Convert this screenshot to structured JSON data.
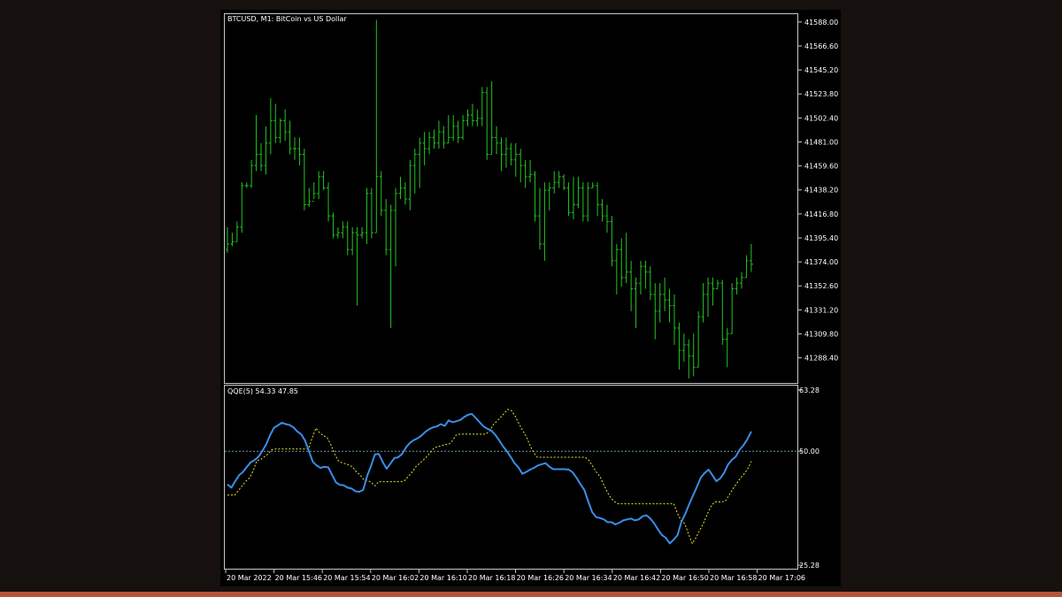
{
  "colors": {
    "page_bg": "#16110e",
    "chart_bg": "#000000",
    "frame": "#c8c8c8",
    "candle": "#22c422",
    "qqe_line": "#3a8ee6",
    "qqe_signal": "#e6e632",
    "level_line": "#6a9ab0",
    "text": "#ffffff",
    "bottom_strip": "#b5543a"
  },
  "chart_data": [
    {
      "type": "ohlc",
      "title": "BTCUSD, M1:  BitCoin vs US Dollar",
      "ylim": [
        41266,
        41595
      ],
      "y_ticks": [
        "41588.00",
        "41566.60",
        "41545.20",
        "41523.80",
        "41502.40",
        "41481.00",
        "41459.60",
        "41438.20",
        "41416.80",
        "41395.40",
        "41374.00",
        "41352.60",
        "41331.20",
        "41309.80",
        "41288.40"
      ],
      "x_ticks": [
        "20 Mar 2022",
        "20 Mar 15:46",
        "20 Mar 15:54",
        "20 Mar 16:02",
        "20 Mar 16:10",
        "20 Mar 16:18",
        "20 Mar 16:26",
        "20 Mar 16:34",
        "20 Mar 16:42",
        "20 Mar 16:50",
        "20 Mar 16:58",
        "20 Mar 17:06"
      ],
      "bars": [
        [
          41385,
          41382,
          41405,
          41390
        ],
        [
          41390,
          41388,
          41400,
          41392
        ],
        [
          41392,
          41392,
          41410,
          41405
        ],
        [
          41405,
          41400,
          41445,
          41442
        ],
        [
          41442,
          41440,
          41445,
          41442
        ],
        [
          41442,
          41440,
          41465,
          41460
        ],
        [
          41460,
          41455,
          41505,
          41470
        ],
        [
          41470,
          41455,
          41480,
          41460
        ],
        [
          41460,
          41452,
          41495,
          41480
        ],
        [
          41480,
          41470,
          41520,
          41500
        ],
        [
          41500,
          41480,
          41515,
          41485
        ],
        [
          41485,
          41480,
          41502,
          41500
        ],
        [
          41500,
          41482,
          41510,
          41490
        ],
        [
          41490,
          41470,
          41500,
          41475
        ],
        [
          41475,
          41465,
          41485,
          41475
        ],
        [
          41475,
          41460,
          41485,
          41470
        ],
        [
          41470,
          41420,
          41475,
          41425
        ],
        [
          41425,
          41423,
          41440,
          41428
        ],
        [
          41428,
          41430,
          41445,
          41435
        ],
        [
          41435,
          41430,
          41455,
          41450
        ],
        [
          41450,
          41438,
          41455,
          41440
        ],
        [
          41440,
          41410,
          41445,
          41415
        ],
        [
          41415,
          41395,
          41418,
          41398
        ],
        [
          41398,
          41395,
          41405,
          41400
        ],
        [
          41400,
          41395,
          41410,
          41405
        ],
        [
          41405,
          41380,
          41410,
          41385
        ],
        [
          41385,
          41380,
          41405,
          41400
        ],
        [
          41400,
          41335,
          41405,
          41398
        ],
        [
          41398,
          41395,
          41405,
          41400
        ],
        [
          41400,
          41390,
          41440,
          41435
        ],
        [
          41435,
          41395,
          41440,
          41400
        ],
        [
          41400,
          41400,
          41590,
          41450
        ],
        [
          41450,
          41415,
          41455,
          41420
        ],
        [
          41420,
          41380,
          41430,
          41385
        ],
        [
          41385,
          41315,
          41425,
          41420
        ],
        [
          41420,
          41370,
          41440,
          41435
        ],
        [
          41435,
          41430,
          41450,
          41440
        ],
        [
          41440,
          41425,
          41445,
          41430
        ],
        [
          41430,
          41420,
          41465,
          41460
        ],
        [
          41460,
          41435,
          41475,
          41470
        ],
        [
          41470,
          41440,
          41485,
          41480
        ],
        [
          41480,
          41460,
          41490,
          41475
        ],
        [
          41475,
          41470,
          41490,
          41485
        ],
        [
          41485,
          41475,
          41492,
          41480
        ],
        [
          41480,
          41475,
          41500,
          41490
        ],
        [
          41490,
          41475,
          41495,
          41480
        ],
        [
          41480,
          41480,
          41505,
          41485
        ],
        [
          41485,
          41482,
          41505,
          41495
        ],
        [
          41495,
          41480,
          41500,
          41485
        ],
        [
          41485,
          41483,
          41505,
          41500
        ],
        [
          41500,
          41495,
          41510,
          41505
        ],
        [
          41505,
          41495,
          41515,
          41500
        ],
        [
          41500,
          41495,
          41510,
          41502
        ],
        [
          41502,
          41495,
          41530,
          41525
        ],
        [
          41525,
          41465,
          41530,
          41470
        ],
        [
          41470,
          41470,
          41535,
          41485
        ],
        [
          41485,
          41470,
          41495,
          41480
        ],
        [
          41480,
          41455,
          41485,
          41470
        ],
        [
          41470,
          41458,
          41485,
          41475
        ],
        [
          41475,
          41460,
          41480,
          41465
        ],
        [
          41465,
          41450,
          41480,
          41470
        ],
        [
          41470,
          41445,
          41475,
          41460
        ],
        [
          41460,
          41440,
          41465,
          41450
        ],
        [
          41450,
          41445,
          41465,
          41452
        ],
        [
          41452,
          41410,
          41455,
          41415
        ],
        [
          41415,
          41385,
          41440,
          41390
        ],
        [
          41390,
          41375,
          41445,
          41438
        ],
        [
          41438,
          41420,
          41445,
          41440
        ],
        [
          41440,
          41435,
          41455,
          41445
        ],
        [
          41445,
          41440,
          41455,
          41450
        ],
        [
          41450,
          41438,
          41452,
          41440
        ],
        [
          41440,
          41415,
          41445,
          41418
        ],
        [
          41418,
          41412,
          41450,
          41425
        ],
        [
          41425,
          41422,
          41450,
          41440
        ],
        [
          41440,
          41410,
          41445,
          41415
        ],
        [
          41415,
          41410,
          41445,
          41440
        ],
        [
          41440,
          41440,
          41445,
          41442
        ],
        [
          41442,
          41415,
          41445,
          41425
        ],
        [
          41425,
          41410,
          41430,
          41415
        ],
        [
          41415,
          41400,
          41425,
          41410
        ],
        [
          41410,
          41370,
          41415,
          41375
        ],
        [
          41375,
          41345,
          41390,
          41385
        ],
        [
          41385,
          41352,
          41395,
          41360
        ],
        [
          41360,
          41355,
          41400,
          41365
        ],
        [
          41365,
          41330,
          41375,
          41350
        ],
        [
          41350,
          41315,
          41360,
          41355
        ],
        [
          41355,
          41345,
          41375,
          41370
        ],
        [
          41370,
          41350,
          41375,
          41365
        ],
        [
          41365,
          41340,
          41370,
          41345
        ],
        [
          41345,
          41305,
          41355,
          41330
        ],
        [
          41330,
          41320,
          41355,
          41345
        ],
        [
          41345,
          41330,
          41360,
          41340
        ],
        [
          41340,
          41320,
          41350,
          41335
        ],
        [
          41335,
          41300,
          41345,
          41315
        ],
        [
          41315,
          41278,
          41320,
          41295
        ],
        [
          41295,
          41285,
          41310,
          41300
        ],
        [
          41300,
          41270,
          41305,
          41290
        ],
        [
          41290,
          41272,
          41310,
          41280
        ],
        [
          41280,
          41280,
          41330,
          41325
        ],
        [
          41325,
          41320,
          41355,
          41345
        ],
        [
          41345,
          41325,
          41360,
          41355
        ],
        [
          41355,
          41335,
          41360,
          41350
        ],
        [
          41350,
          41350,
          41358,
          41355
        ],
        [
          41355,
          41300,
          41358,
          41305
        ],
        [
          41305,
          41280,
          41315,
          41310
        ],
        [
          41310,
          41310,
          41355,
          41350
        ],
        [
          41350,
          41345,
          41360,
          41355
        ],
        [
          41355,
          41350,
          41365,
          41360
        ],
        [
          41360,
          41360,
          41380,
          41375
        ],
        [
          41375,
          41365,
          41390,
          41372
        ]
      ]
    },
    {
      "type": "line",
      "title": "QQE(5) 54.33 47.85",
      "ylim": [
        25.28,
        63.28
      ],
      "y_ticks": [
        "63.28",
        "50.00",
        "25.28"
      ],
      "level": 50.0,
      "series": [
        {
          "values": [
            42.8,
            42.1,
            43.5,
            44.8,
            45.5,
            46.6,
            47.6,
            48.1,
            48.8,
            50.1,
            51.5,
            53.5,
            55.1,
            55.6,
            56.2,
            55.9,
            55.7,
            55.2,
            54.3,
            53.7,
            52.3,
            50.0,
            47.7,
            46.9,
            46.4,
            46.6,
            46.5,
            44.8,
            43.2,
            42.7,
            42.6,
            42.1,
            41.9,
            41.3,
            41.2,
            41.6,
            44.6,
            46.8,
            49.3,
            49.4,
            47.7,
            46.2,
            47.3,
            48.5,
            48.7,
            49.4,
            50.8,
            51.8,
            52.4,
            52.8,
            53.4,
            54.2,
            54.8,
            55.2,
            55.4,
            55.9,
            55.5,
            56.7,
            56.3,
            56.5,
            56.8,
            57.4,
            57.9,
            58.1,
            57.2,
            56.3,
            55.4,
            54.9,
            54.5,
            53.6,
            52.4,
            51.1,
            50.0,
            48.8,
            47.4,
            46.5,
            45.1,
            45.5,
            46.0,
            46.4,
            46.9,
            47.2,
            47.4,
            46.6,
            46.1,
            46.1,
            46.1,
            46.1,
            46.0,
            45.4,
            44.2,
            42.8,
            41.6,
            39.1,
            36.8,
            35.7,
            35.5,
            35.2,
            34.6,
            34.6,
            34.1,
            34.5,
            35.0,
            35.2,
            35.4,
            35.0,
            35.2,
            35.9,
            36.1,
            35.4,
            34.3,
            33.0,
            31.8,
            31.2,
            30.0,
            30.8,
            31.8,
            34.7,
            36.4,
            38.5,
            40.4,
            42.3,
            44.3,
            45.3,
            46.0,
            44.8,
            43.5,
            44.1,
            45.3,
            47.1,
            48.1,
            48.8,
            50.3,
            51.3,
            52.6,
            54.3
          ]
        },
        {
          "values": [
            40.5,
            40.5,
            40.5,
            41.5,
            42.5,
            43.5,
            44.2,
            45.8,
            48.0,
            48.2,
            48.8,
            49.4,
            50.3,
            50.5,
            50.5,
            50.5,
            50.5,
            50.5,
            50.5,
            50.5,
            50.5,
            50.5,
            50.5,
            53.0,
            55.0,
            54.0,
            53.4,
            53.0,
            51.5,
            49.5,
            48.0,
            47.5,
            47.3,
            47.0,
            46.5,
            45.5,
            44.8,
            43.8,
            43.7,
            43.2,
            42.5,
            43.4,
            43.4,
            43.4,
            43.4,
            43.4,
            43.4,
            43.4,
            43.6,
            44.5,
            45.4,
            46.6,
            47.3,
            48.0,
            48.8,
            49.7,
            50.7,
            51.0,
            51.2,
            51.5,
            51.5,
            52.3,
            53.5,
            53.7,
            53.7,
            53.7,
            53.7,
            53.7,
            53.7,
            53.7,
            53.7,
            54.3,
            55.7,
            56.5,
            57.3,
            58.2,
            59.1,
            58.8,
            57.6,
            56.0,
            54.6,
            53.2,
            51.3,
            49.7,
            48.7,
            48.7,
            48.7,
            48.7,
            48.7,
            48.7,
            48.7,
            48.7,
            48.7,
            48.7,
            48.7,
            48.7,
            48.7,
            48.7,
            48.0,
            46.8,
            45.5,
            44.5,
            42.8,
            41.1,
            39.8,
            39.0,
            38.6,
            38.6,
            38.6,
            38.6,
            38.6,
            38.6,
            38.6,
            38.6,
            38.6,
            38.6,
            38.6,
            38.6,
            38.6,
            38.6,
            38.6,
            38.6,
            36.5,
            34.9,
            34.3,
            32.0,
            30.0,
            31.2,
            32.8,
            34.3,
            36.2,
            37.9,
            39.0,
            39.0,
            39.0,
            39.2,
            40.5,
            41.8,
            43.0,
            44.1,
            45.0,
            46.1,
            47.8
          ]
        }
      ]
    }
  ],
  "x_axis_labels": [
    "20 Mar 2022",
    "20 Mar 15:46",
    "20 Mar 15:54",
    "20 Mar 16:02",
    "20 Mar 16:10",
    "20 Mar 16:18",
    "20 Mar 16:26",
    "20 Mar 16:34",
    "20 Mar 16:42",
    "20 Mar 16:50",
    "20 Mar 16:58",
    "20 Mar 17:06"
  ]
}
